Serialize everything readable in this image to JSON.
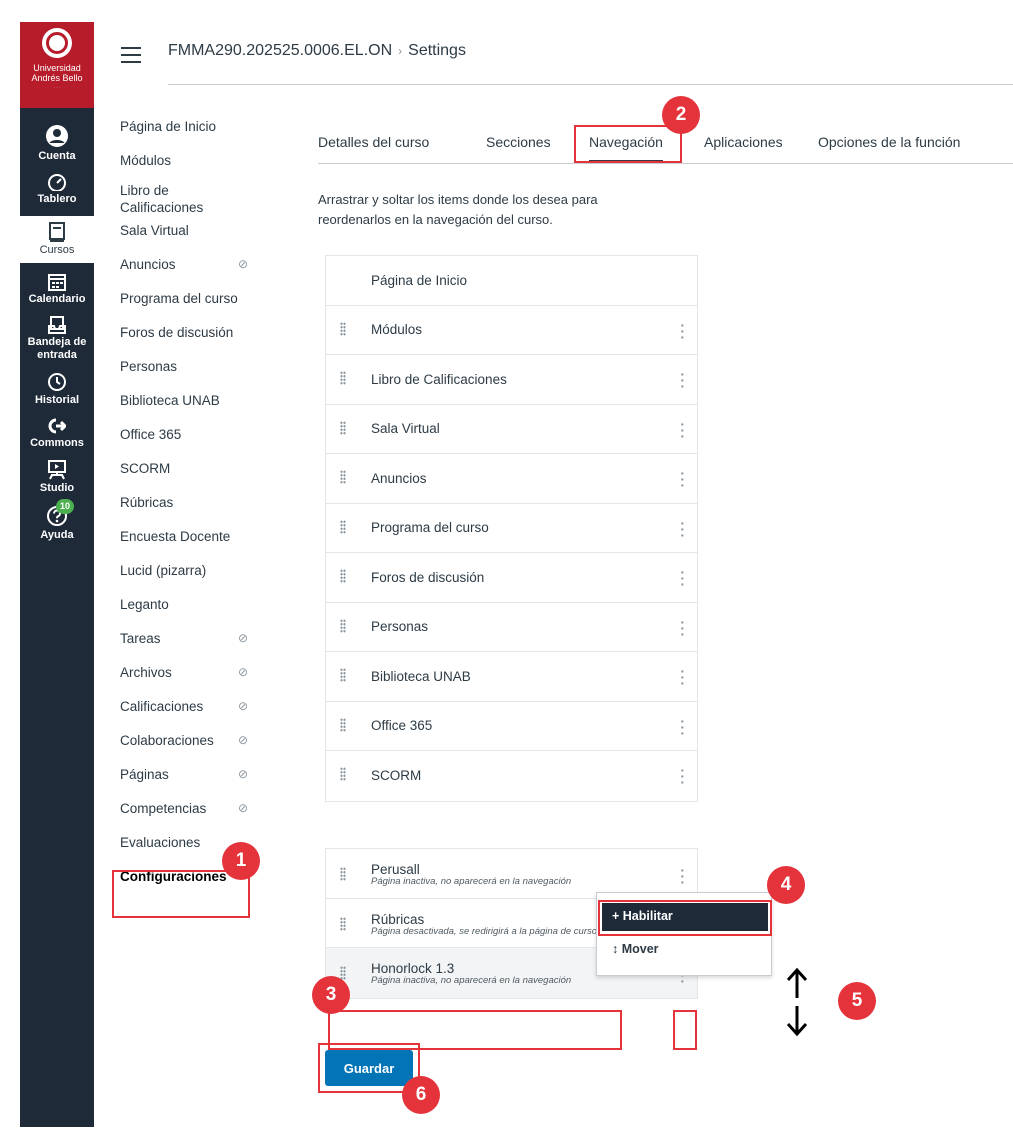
{
  "logo": {
    "line1": "Universidad",
    "line2": "Andrés Bello",
    "line3": "· · ·"
  },
  "global_nav": {
    "items": [
      {
        "label": "Cuenta",
        "icon": "user-icon"
      },
      {
        "label": "Tablero",
        "icon": "dashboard-icon"
      },
      {
        "label": "Cursos",
        "icon": "book-icon"
      },
      {
        "label": "Calendario",
        "icon": "calendar-icon"
      },
      {
        "label": "Bandeja de entrada",
        "icon": "inbox-icon"
      },
      {
        "label": "Historial",
        "icon": "clock-icon"
      },
      {
        "label": "Commons",
        "icon": "commons-icon"
      },
      {
        "label": "Studio",
        "icon": "studio-icon"
      },
      {
        "label": "Ayuda",
        "icon": "help-icon",
        "badge": "10"
      }
    ]
  },
  "header": {
    "course": "FMMA290.202525.0006.EL.ON",
    "separator": "›",
    "page": "Settings"
  },
  "course_nav": {
    "items": [
      {
        "label": "Página de Inicio"
      },
      {
        "label": "Módulos"
      },
      {
        "label": "Libro de Calificaciones"
      },
      {
        "label": "Sala Virtual"
      },
      {
        "label": "Anuncios",
        "hidden": true
      },
      {
        "label": "Programa del curso"
      },
      {
        "label": "Foros de discusión"
      },
      {
        "label": "Personas"
      },
      {
        "label": "Biblioteca UNAB"
      },
      {
        "label": "Office 365"
      },
      {
        "label": "SCORM"
      },
      {
        "label": "Rúbricas"
      },
      {
        "label": "Encuesta Docente"
      },
      {
        "label": "Lucid (pizarra)"
      },
      {
        "label": "Leganto"
      },
      {
        "label": "Tareas",
        "hidden": true
      },
      {
        "label": "Archivos",
        "hidden": true
      },
      {
        "label": "Calificaciones",
        "hidden": true
      },
      {
        "label": "Colaboraciones",
        "hidden": true
      },
      {
        "label": "Páginas",
        "hidden": true
      },
      {
        "label": "Competencias",
        "hidden": true
      },
      {
        "label": "Evaluaciones"
      },
      {
        "label": "Configuraciones",
        "active": true
      }
    ],
    "hidden_icon": "eye-slash-icon"
  },
  "tabs": [
    "Detalles del curso",
    "Secciones",
    "Navegación",
    "Aplicaciones",
    "Opciones de la función"
  ],
  "instructions": "Arrastrar y soltar los items donde los desea para reordenarlos en la navegación del curso.",
  "enabled_items": [
    "Página de Inicio",
    "Módulos",
    "Libro de Calificaciones",
    "Sala Virtual",
    "Anuncios",
    "Programa del curso",
    "Foros de discusión",
    "Personas",
    "Biblioteca UNAB",
    "Office 365",
    "SCORM"
  ],
  "disabled_items": [
    {
      "title": "Perusall",
      "note": "Página inactiva, no aparecerá en la navegación"
    },
    {
      "title": "Rúbricas",
      "note": "Página desactivada, se redirigirá a la página de curso"
    },
    {
      "title": "Honorlock 1.3",
      "note": "Página inactiva, no aparecerá en la navegación"
    }
  ],
  "menu": {
    "enable": "+ Habilitar",
    "move": "↕ Mover"
  },
  "save_label": "Guardar",
  "annotations": [
    "1",
    "2",
    "3",
    "4",
    "5",
    "6"
  ],
  "colors": {
    "nav_bg": "#1f2a38",
    "brand_red": "#b71c2a",
    "annotation_red": "#e5333b",
    "primary_blue": "#0374b5"
  }
}
